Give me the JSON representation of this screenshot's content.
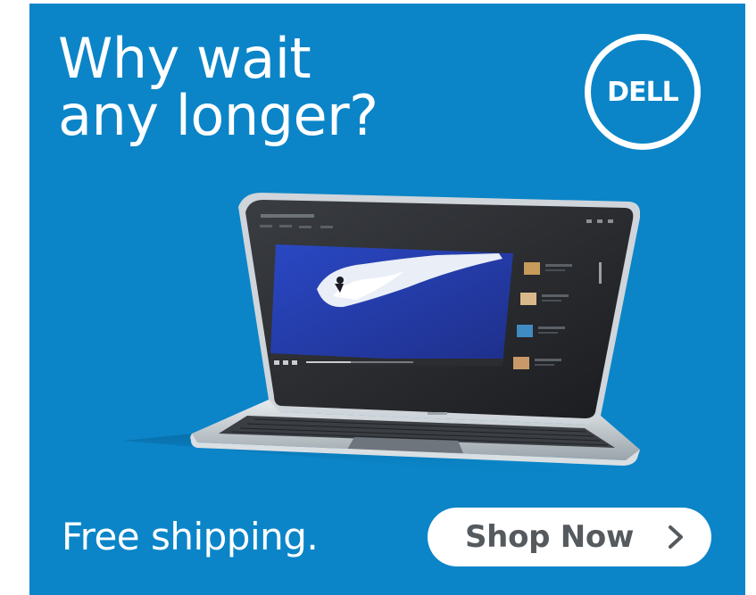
{
  "ad": {
    "headline_line1": "Why wait",
    "headline_line2": "any longer?",
    "brand": "DELL",
    "tagline": "Free shipping.",
    "cta_label": "Shop Now",
    "cta_icon": "chevron-right-icon",
    "colors": {
      "background": "#0b85c8",
      "text": "#ffffff",
      "button_bg": "#ffffff",
      "button_text": "#555a5e"
    }
  },
  "laptop_screen": {
    "app_title": "Dell Stage",
    "menu_items": [
      "Videos",
      "Music",
      "Photos",
      "Docs"
    ]
  }
}
